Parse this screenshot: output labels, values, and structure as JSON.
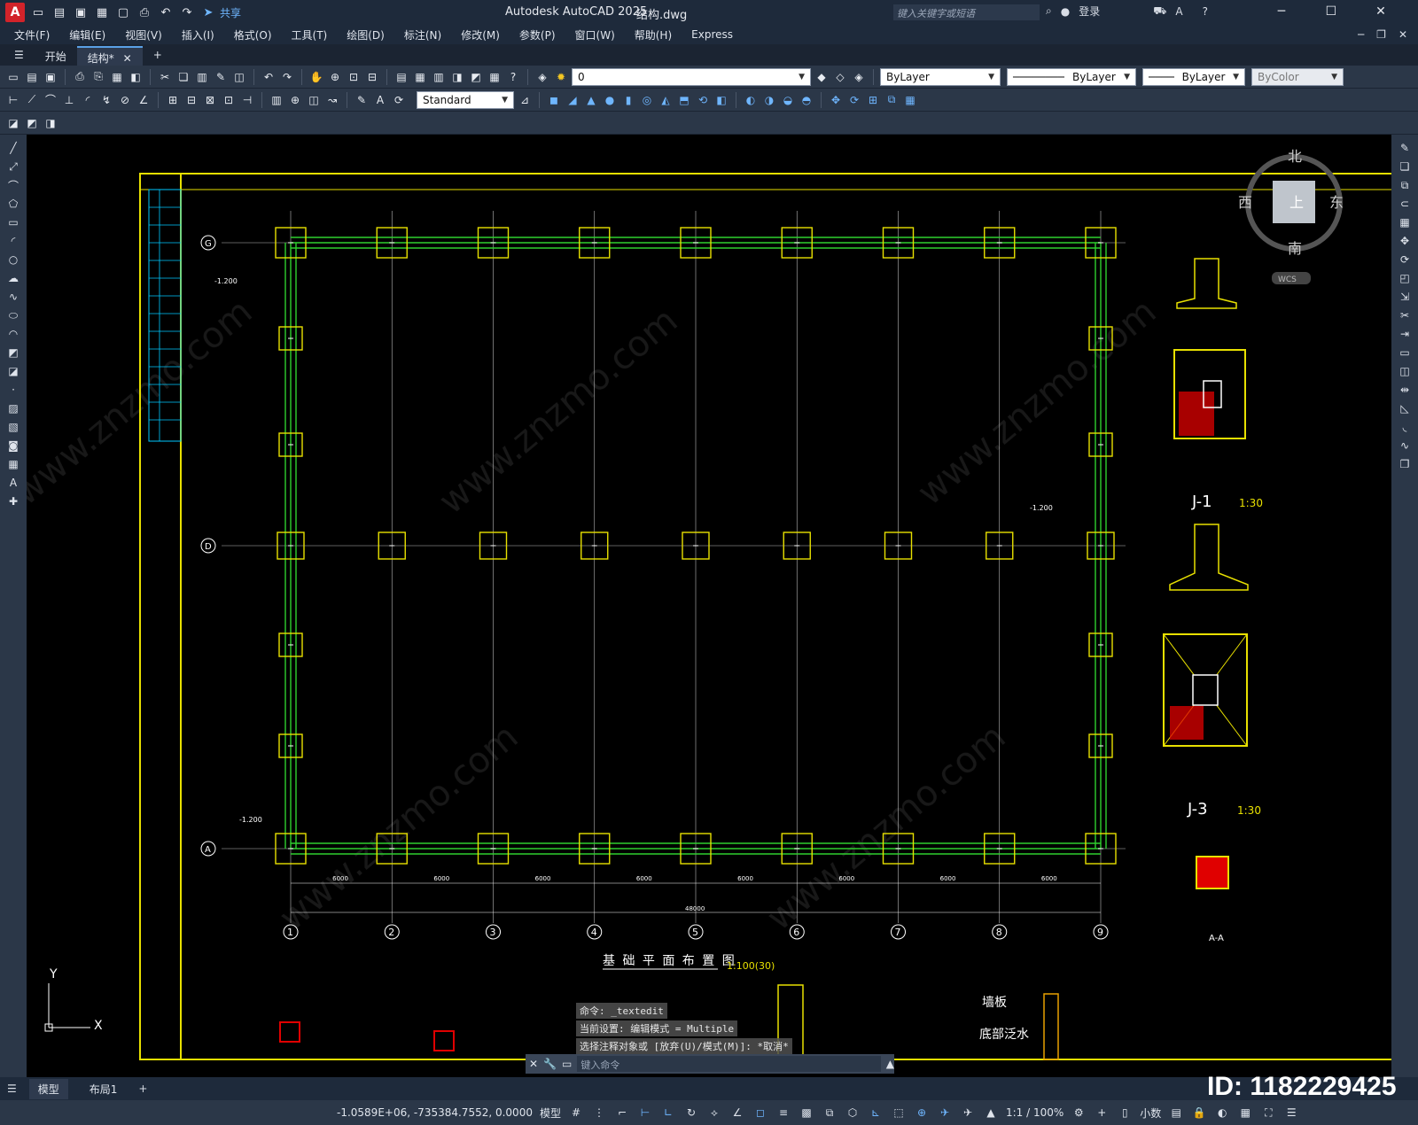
{
  "titlebar": {
    "app_name": "Autodesk AutoCAD 2025",
    "file_name": "结构.dwg",
    "share_label": "共享",
    "search_placeholder": "键入关键字或短语",
    "login_label": "登录"
  },
  "menu": {
    "items": [
      "文件(F)",
      "编辑(E)",
      "视图(V)",
      "插入(I)",
      "格式(O)",
      "工具(T)",
      "绘图(D)",
      "标注(N)",
      "修改(M)",
      "参数(P)",
      "窗口(W)",
      "帮助(H)",
      "Express"
    ]
  },
  "tabs": {
    "start": "开始",
    "active": "结构*",
    "add": "+"
  },
  "toolbar": {
    "layer_value": "0",
    "color_value": "ByLayer",
    "linetype_value": "ByLayer",
    "lineweight_value": "ByLayer",
    "plotstyle_value": "ByColor",
    "textstyle_value": "Standard"
  },
  "viewcube": {
    "north": "北",
    "south": "南",
    "east": "东",
    "west": "西",
    "top": "上",
    "wcs": "WCS"
  },
  "drawing": {
    "plan_title": "基 础 平 面 布 置 图",
    "plan_scale": "1:100(30)",
    "axis_numbers": [
      "1",
      "2",
      "3",
      "4",
      "5",
      "6",
      "7",
      "8",
      "9"
    ],
    "axis_letters": [
      "G",
      "D",
      "A"
    ],
    "span_label": "6000",
    "total_label": "48000",
    "detail_j1": "J-1",
    "detail_j1_scale": "1:30",
    "detail_j3": "J-3",
    "detail_j3_scale": "1:30",
    "section_aa": "A-A",
    "elev_label": "-1.200",
    "ucs_x": "X",
    "ucs_y": "Y",
    "text_wall": "墙板",
    "text_waterproof": "底部泛水"
  },
  "command": {
    "history": [
      "命令: _textedit",
      "当前设置: 编辑模式 = Multiple",
      "选择注释对象或 [放弃(U)/模式(M)]: *取消*"
    ],
    "input_placeholder": "键入命令"
  },
  "layout_tabs": {
    "model": "模型",
    "layout1": "布局1"
  },
  "status": {
    "coords": "-1.0589E+06, -735384.7552, 0.0000",
    "space": "模型",
    "scale": "1:1 / 100%",
    "units": "小数"
  },
  "watermark": {
    "id_text": "ID: 1182229425"
  }
}
